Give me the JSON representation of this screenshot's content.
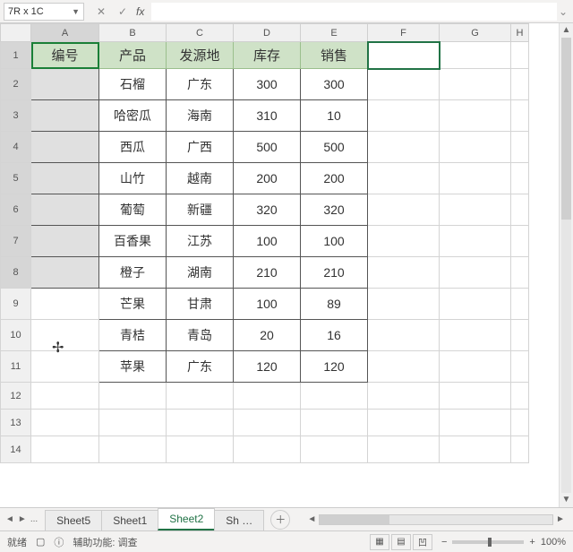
{
  "namebox": "7R x 1C",
  "fx_label": "fx",
  "columns": [
    "A",
    "B",
    "C",
    "D",
    "E",
    "F",
    "G",
    "H"
  ],
  "selected_col": "A",
  "selected_rows": [
    1,
    2,
    3,
    4,
    5,
    6,
    7,
    8
  ],
  "active_cell": "F1",
  "headers": {
    "A": "编号",
    "B": "产品",
    "C": "发源地",
    "D": "库存",
    "E": "销售"
  },
  "rows": [
    {
      "B": "石榴",
      "C": "广东",
      "D": "300",
      "E": "300"
    },
    {
      "B": "哈密瓜",
      "C": "海南",
      "D": "310",
      "E": "10"
    },
    {
      "B": "西瓜",
      "C": "广西",
      "D": "500",
      "E": "500"
    },
    {
      "B": "山竹",
      "C": "越南",
      "D": "200",
      "E": "200"
    },
    {
      "B": "葡萄",
      "C": "新疆",
      "D": "320",
      "E": "320"
    },
    {
      "B": "百香果",
      "C": "江苏",
      "D": "100",
      "E": "100"
    },
    {
      "B": "橙子",
      "C": "湖南",
      "D": "210",
      "E": "210"
    },
    {
      "B": "芒果",
      "C": "甘肃",
      "D": "100",
      "E": "89"
    },
    {
      "B": "青桔",
      "C": "青岛",
      "D": "20",
      "E": "16"
    },
    {
      "B": "苹果",
      "C": "广东",
      "D": "120",
      "E": "120"
    }
  ],
  "blank_rows": [
    12,
    13,
    14
  ],
  "tabs": {
    "items": [
      "Sheet5",
      "Sheet1",
      "Sheet2",
      "Sh …"
    ],
    "active": "Sheet2",
    "ellipsis": "..."
  },
  "status": {
    "mode": "就绪",
    "access": "辅助功能: 调查"
  },
  "zoom": {
    "label": "100%"
  }
}
